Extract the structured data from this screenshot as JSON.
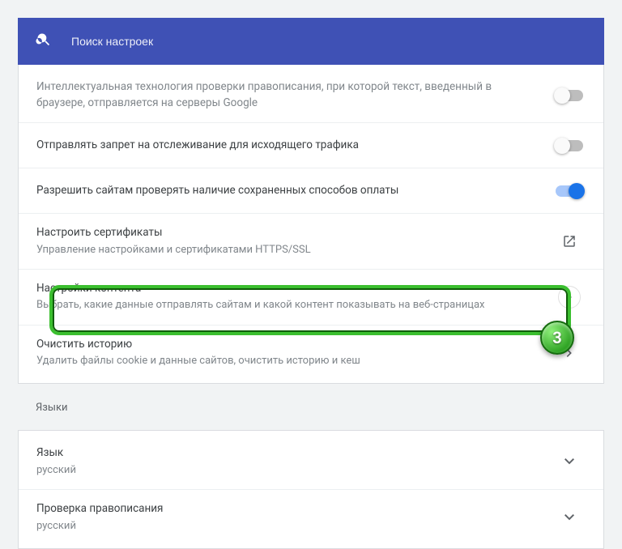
{
  "search": {
    "placeholder": "Поиск настроек"
  },
  "rows": {
    "spellcheck_service": {
      "title": "Интеллектуальная технология проверки правописания, при которой текст, введенный в браузере, отправляется на серверы Google",
      "on": false
    },
    "dnt": {
      "title": "Отправлять запрет на отслеживание для исходящего трафика",
      "on": false
    },
    "payment_check": {
      "title": "Разрешить сайтам проверять наличие сохраненных способов оплаты",
      "on": true
    },
    "certs": {
      "title": "Настроить сертификаты",
      "sub": "Управление настройками и сертификатами HTTPS/SSL"
    },
    "content": {
      "title": "Настройки контента",
      "sub": "Выбрать, какие данные отправлять сайтам и какой контент показывать на веб-страницах"
    },
    "clear": {
      "title": "Очистить историю",
      "sub": "Удалить файлы cookie и данные сайтов, очистить историю и кеш"
    }
  },
  "languages": {
    "heading": "Языки",
    "lang": {
      "title": "Язык",
      "value": "русский"
    },
    "spell": {
      "title": "Проверка правописания",
      "value": "русский"
    }
  },
  "annotation": {
    "step": "3"
  }
}
